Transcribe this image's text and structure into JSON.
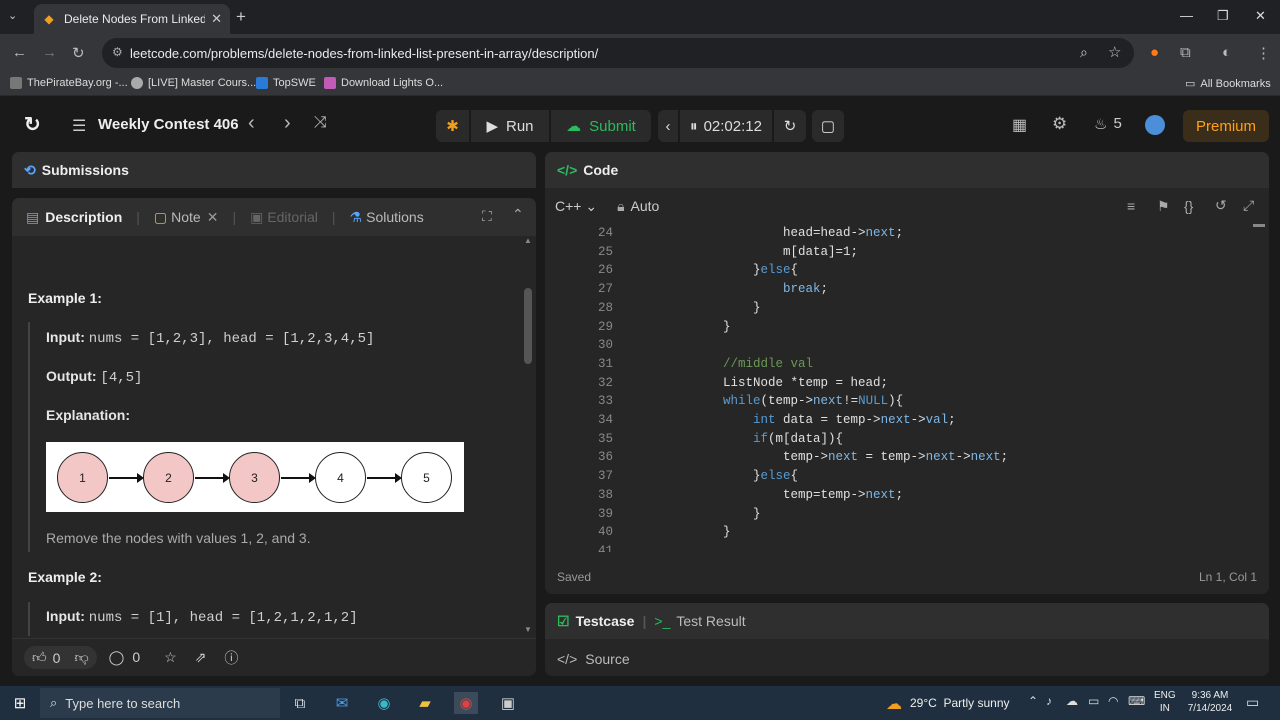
{
  "browser": {
    "tab_title": "Delete Nodes From Linked List",
    "url": "leetcode.com/problems/delete-nodes-from-linked-list-present-in-array/description/",
    "bookmarks": [
      "ThePirateBay.org -...",
      "[LIVE] Master Cours...",
      "TopSWE",
      "Download Lights O..."
    ],
    "all_bookmarks": "All Bookmarks"
  },
  "topbar": {
    "contest": "Weekly Contest 406",
    "run": "Run",
    "submit": "Submit",
    "timer": "02:02:12",
    "streak": "5",
    "premium": "Premium"
  },
  "submissions": {
    "title": "Submissions"
  },
  "description": {
    "tabs": {
      "description": "Description",
      "note": "Note",
      "editorial": "Editorial",
      "solutions": "Solutions"
    },
    "example1": {
      "title": "Example 1:",
      "input_label": "Input:",
      "input_value": "nums = [1,2,3], head = [1,2,3,4,5]",
      "output_label": "Output:",
      "output_value": "[4,5]",
      "explanation_label": "Explanation:",
      "nodes": [
        "1",
        "2",
        "3",
        "4",
        "5"
      ],
      "removed_nodes": [
        true,
        true,
        true,
        false,
        false
      ],
      "note": "Remove the nodes with values 1, 2, and 3."
    },
    "example2": {
      "title": "Example 2:",
      "input_label": "Input:",
      "input_value": "nums = [1], head = [1,2,1,2,1,2]"
    },
    "footer": {
      "likes": "0",
      "comments": "0"
    }
  },
  "code": {
    "title": "Code",
    "language": "C++",
    "mode": "Auto",
    "lines": [
      {
        "n": "24",
        "text": "                head=head->next;"
      },
      {
        "n": "25",
        "text": "                m[data]=1;"
      },
      {
        "n": "26",
        "text": "            }else{"
      },
      {
        "n": "27",
        "text": "                break;"
      },
      {
        "n": "28",
        "text": "            }"
      },
      {
        "n": "29",
        "text": "        }"
      },
      {
        "n": "30",
        "text": ""
      },
      {
        "n": "31",
        "text": "        //middle val"
      },
      {
        "n": "32",
        "text": "        ListNode *temp = head;"
      },
      {
        "n": "33",
        "text": "        while(temp->next!=NULL){"
      },
      {
        "n": "34",
        "text": "            int data = temp->next->val;"
      },
      {
        "n": "35",
        "text": "            if(m[data]){"
      },
      {
        "n": "36",
        "text": "                temp->next = temp->next->next;"
      },
      {
        "n": "37",
        "text": "            }else{"
      },
      {
        "n": "38",
        "text": "                temp=temp->next;"
      },
      {
        "n": "39",
        "text": "            }"
      },
      {
        "n": "40",
        "text": "        }"
      },
      {
        "n": "41",
        "text": ""
      }
    ],
    "status": "Saved",
    "cursor": "Ln 1, Col 1"
  },
  "bottom": {
    "testcase": "Testcase",
    "test_result": "Test Result",
    "source": "Source"
  },
  "taskbar": {
    "search_placeholder": "Type here to search",
    "weather": "29°C  Partly sunny",
    "lang_top": "ENG",
    "lang_bottom": "IN",
    "time": "9:36 AM",
    "date": "7/14/2024"
  },
  "colors": {
    "accent_green": "#2cbb5d",
    "premium": "#ffa116",
    "removed_node": "#f4c7c7"
  }
}
